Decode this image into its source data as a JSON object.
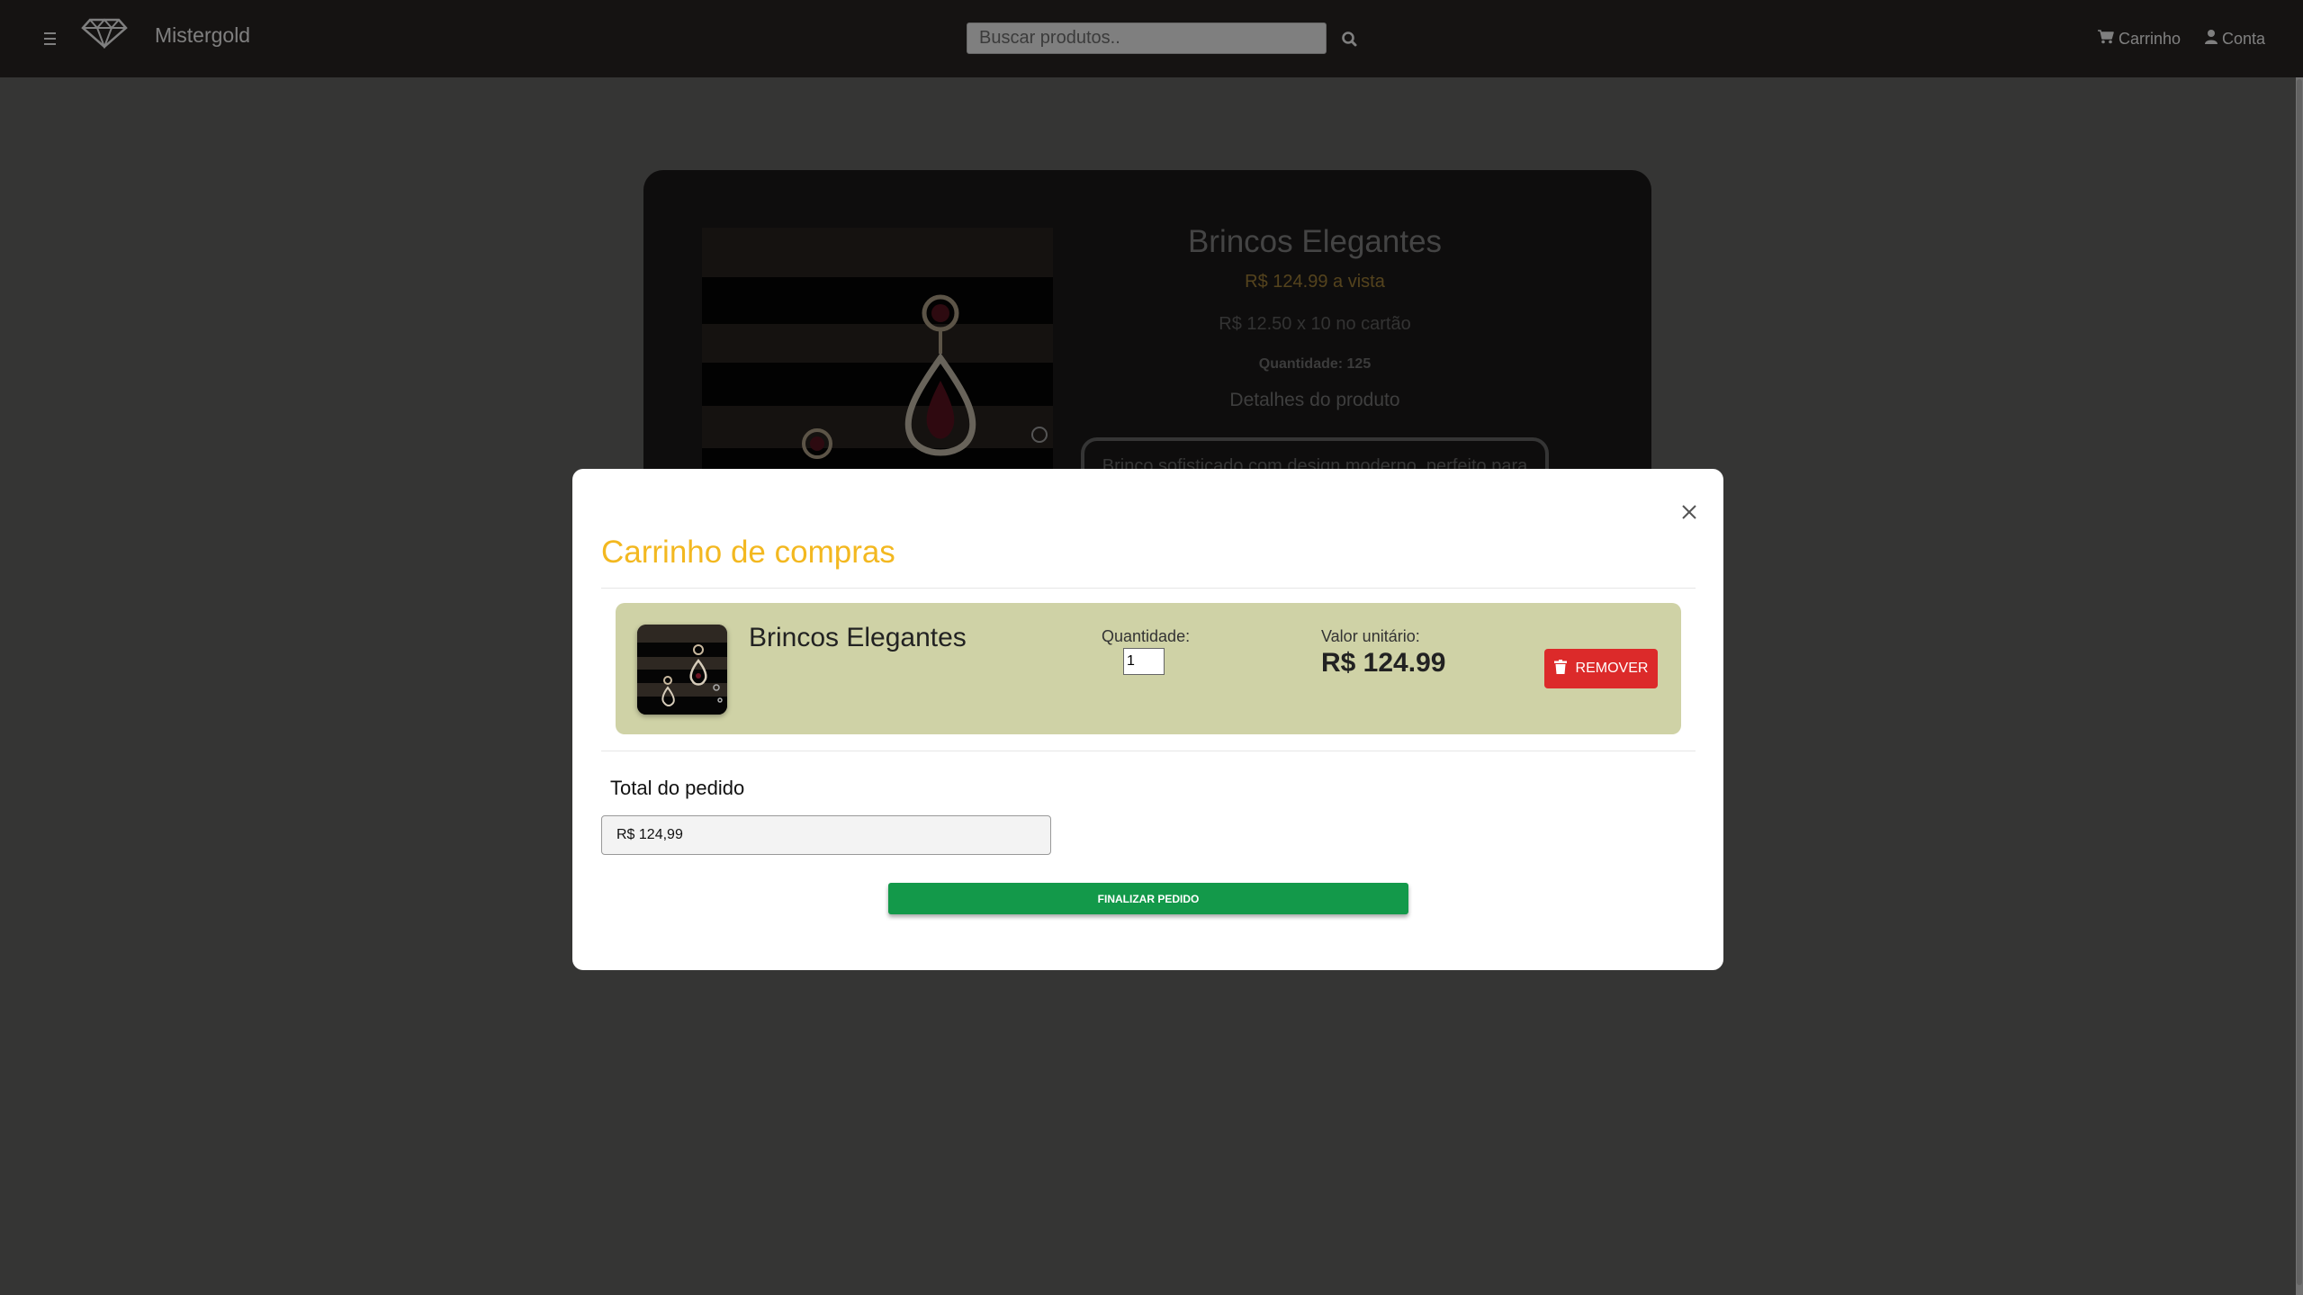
{
  "navbar": {
    "brand": "Mistergold",
    "search_placeholder": "Buscar produtos..",
    "search_value": "",
    "cart_label": "Carrinho",
    "account_label": "Conta"
  },
  "product": {
    "title": "Brincos Elegantes",
    "price": "R$ 124.99 a vista",
    "installments": "R$ 12.50 x 10 no cartão",
    "quantity": "Quantidade: 125",
    "details_label": "Detalhes do produto",
    "description": "Brinco sofisticado com design moderno, perfeito para"
  },
  "modal": {
    "title": "Carrinho de compras",
    "items": [
      {
        "name": "Brincos Elegantes",
        "quantity_label": "Quantidade:",
        "quantity_value": "1",
        "unit_price_label": "Valor unitário:",
        "unit_price": "R$ 124.99",
        "remove_label": "REMOVER"
      }
    ],
    "total_label": "Total do pedido",
    "total_value": "R$ 124,99",
    "checkout_label": "FINALIZAR PEDIDO"
  },
  "colors": {
    "navbar_bg": "#2b2725",
    "accent": "#f3b820",
    "remove_button": "#dc2a2a",
    "checkout_button": "#13994a",
    "cart_item_bg": "#cfd2a6"
  },
  "icons": {
    "menu": "hamburger-icon",
    "logo": "diamond-logo",
    "search": "search-icon",
    "cart": "cart-icon",
    "account": "user-icon",
    "close": "close-icon",
    "trash": "trash-icon"
  }
}
